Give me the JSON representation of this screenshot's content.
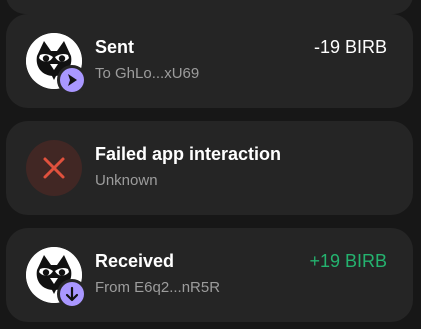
{
  "colors": {
    "background": "#171717",
    "card": "#252525",
    "primary_text": "#ffffff",
    "secondary_text": "#9c9c9c",
    "positive": "#24b36f",
    "badge": "#a997ff",
    "failed_icon_bg": "#412724",
    "failed_icon": "#e0513d"
  },
  "transactions": [
    {
      "title": "Sent",
      "subtitle": "To GhLo...xU69",
      "amount": "-19 BIRB",
      "avatar_icon": "birb-token-icon",
      "badge_icon": "send-arrow-icon"
    },
    {
      "title": "Failed app interaction",
      "subtitle": "Unknown",
      "amount": "",
      "status_icon": "close-icon"
    },
    {
      "title": "Received",
      "subtitle": "From E6q2...nR5R",
      "amount": "+19 BIRB",
      "avatar_icon": "birb-token-icon",
      "badge_icon": "receive-arrow-icon"
    }
  ]
}
